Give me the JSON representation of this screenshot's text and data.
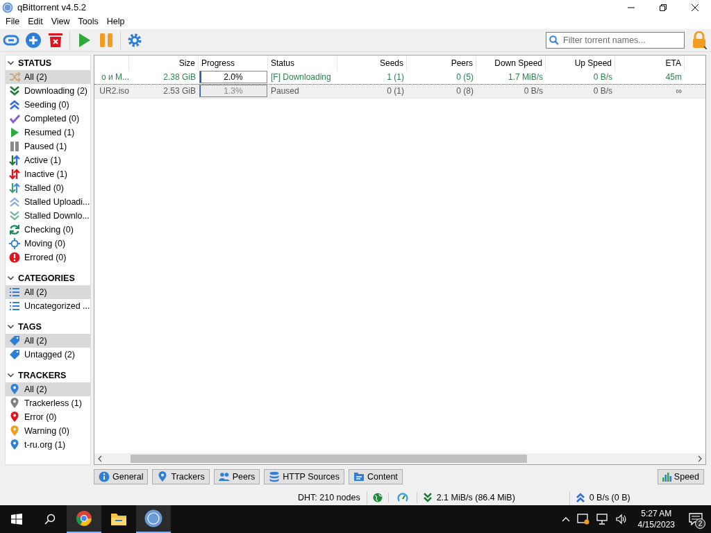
{
  "window": {
    "title": "qBittorrent v4.5.2"
  },
  "menu": [
    "File",
    "Edit",
    "View",
    "Tools",
    "Help"
  ],
  "toolbar": [
    {
      "kind": "link"
    },
    {
      "kind": "add"
    },
    {
      "kind": "delete"
    },
    {
      "kind": "resume"
    },
    {
      "kind": "pause"
    },
    {
      "kind": "settings"
    }
  ],
  "search": {
    "placeholder": "Filter torrent names..."
  },
  "sidebar": [
    {
      "title": "STATUS",
      "expanded": true,
      "items": [
        {
          "label": "All (2)",
          "kind": "shuffle",
          "selected": true
        },
        {
          "label": "Downloading (2)",
          "kind": "down",
          "selected": false
        },
        {
          "label": "Seeding (0)",
          "kind": "up",
          "selected": false
        },
        {
          "label": "Completed (0)",
          "kind": "check",
          "selected": false
        },
        {
          "label": "Resumed (1)",
          "kind": "play",
          "selected": false
        },
        {
          "label": "Paused (1)",
          "kind": "pause",
          "selected": false
        },
        {
          "label": "Active (1)",
          "kind": "active",
          "selected": false
        },
        {
          "label": "Inactive (1)",
          "kind": "inactive",
          "selected": false
        },
        {
          "label": "Stalled (0)",
          "kind": "stalled",
          "selected": false
        },
        {
          "label": "Stalled Uploadi...",
          "kind": "stalled-up",
          "selected": false
        },
        {
          "label": "Stalled Downlo...",
          "kind": "stalled-down",
          "selected": false
        },
        {
          "label": "Checking (0)",
          "kind": "checking",
          "selected": false
        },
        {
          "label": "Moving (0)",
          "kind": "moving",
          "selected": false
        },
        {
          "label": "Errored (0)",
          "kind": "error",
          "selected": false
        }
      ]
    },
    {
      "title": "CATEGORIES",
      "expanded": true,
      "items": [
        {
          "label": "All (2)",
          "kind": "list",
          "selected": true
        },
        {
          "label": "Uncategorized ...",
          "kind": "list",
          "selected": false
        }
      ]
    },
    {
      "title": "TAGS",
      "expanded": true,
      "items": [
        {
          "label": "All (2)",
          "kind": "tag",
          "selected": true
        },
        {
          "label": "Untagged (2)",
          "kind": "tag",
          "selected": false
        }
      ]
    },
    {
      "title": "TRACKERS",
      "expanded": true,
      "items": [
        {
          "label": "All (2)",
          "kind": "pin",
          "color": "#2f7fd8",
          "selected": true
        },
        {
          "label": "Trackerless (1)",
          "kind": "pin",
          "color": "#808080",
          "selected": false
        },
        {
          "label": "Error (0)",
          "kind": "pin",
          "color": "#e0141e",
          "selected": false
        },
        {
          "label": "Warning (0)",
          "kind": "pin",
          "color": "#f39c1f",
          "selected": false
        },
        {
          "label": "t-ru.org (1)",
          "kind": "pin",
          "color": "#2f7fd8",
          "selected": false
        }
      ]
    }
  ],
  "table": {
    "columns": [
      "",
      "Size",
      "Progress",
      "Status",
      "Seeds",
      "Peers",
      "Down Speed",
      "Up Speed",
      "ETA"
    ],
    "rows": [
      {
        "kind": "downloading",
        "column_1": "о и М...",
        "size": "2.38 GiB",
        "progress": "2.0%",
        "level": 0.02,
        "status": "[F] Downloading",
        "seeds": "1 (1)",
        "peers": "0 (5)",
        "down_speed": "1.7 MiB/s",
        "up_speed": "0 B/s",
        "eta": "45m",
        "selected": false
      },
      {
        "kind": "paused",
        "column_1": "UR2.iso",
        "size": "2.53 GiB",
        "progress": "1.3%",
        "level": 0.013,
        "status": "Paused",
        "seeds": "0 (1)",
        "peers": "0 (8)",
        "down_speed": "0 B/s",
        "up_speed": "0 B/s",
        "eta": "∞",
        "selected": true
      }
    ]
  },
  "detail_tabs": [
    {
      "label": "General",
      "kind": "info"
    },
    {
      "label": "Trackers",
      "kind": "pin"
    },
    {
      "label": "Peers",
      "kind": "people"
    },
    {
      "label": "HTTP Sources",
      "kind": "db"
    },
    {
      "label": "Content",
      "kind": "folder"
    }
  ],
  "speed_button": "Speed",
  "status_bar": {
    "dht": "DHT: 210 nodes",
    "download": "2.1 MiB/s (86.4 MiB)",
    "upload": "0 B/s (0 B)"
  },
  "taskbar": {
    "time": "5:27 AM",
    "date": "4/15/2023",
    "notifications": "2"
  }
}
